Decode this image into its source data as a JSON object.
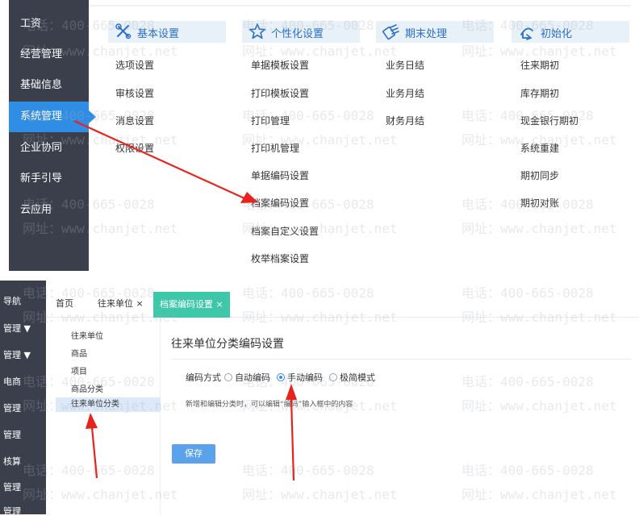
{
  "top": {
    "sidebar": [
      "工资",
      "经营管理",
      "基础信息",
      "系统管理",
      "企业协同",
      "新手引导",
      "云应用"
    ],
    "active_index": 3,
    "columns": [
      {
        "title": "基本设置",
        "icon": "basic-settings-icon",
        "items": [
          "选项设置",
          "审核设置",
          "消息设置",
          "权限设置"
        ]
      },
      {
        "title": "个性化设置",
        "icon": "star-icon",
        "items": [
          "单据模板设置",
          "打印模板设置",
          "打印管理",
          "打印机管理",
          "单据编码设置",
          "档案编码设置",
          "档案自定义设置",
          "枚举档案设置"
        ]
      },
      {
        "title": "期末处理",
        "icon": "period-end-icon",
        "items": [
          "业务日结",
          "业务月结",
          "财务月结"
        ]
      },
      {
        "title": "初始化",
        "icon": "initialize-icon",
        "items": [
          "往来期初",
          "库存期初",
          "现金银行期初",
          "系统重建",
          "期初同步",
          "期初对账"
        ]
      }
    ]
  },
  "bottom": {
    "sidebar": [
      "导航",
      "管理 ▼",
      "管理 ▼",
      "电商",
      "管理",
      "管理",
      "核算",
      "管理",
      "管理"
    ],
    "tabs": {
      "home": "首页",
      "partner": "往来单位 ×",
      "active": "档案编码设置 ×"
    },
    "tree": [
      "往来单位",
      "商品",
      "项目",
      "商品分类",
      "往来单位分类"
    ],
    "selected_tree_index": 4,
    "content": {
      "title": "往来单位分类编码设置",
      "mode_label": "编码方式",
      "options": [
        "自动编码",
        "手动编码",
        "极简模式"
      ],
      "selected_option": 1,
      "hint": "新增和编辑分类时，可以编辑“编码”输入框中的内容",
      "save": "保存"
    }
  },
  "watermark": {
    "phone": "电话：400-665-0028",
    "site": "网址：www.chanjet.net"
  },
  "colors": {
    "sidebar": "#3b3f4c",
    "accent": "#2f8de4",
    "tab_active": "#3fc7a9",
    "arrow": "#e8231d",
    "header_text": "#2a6fc8"
  }
}
